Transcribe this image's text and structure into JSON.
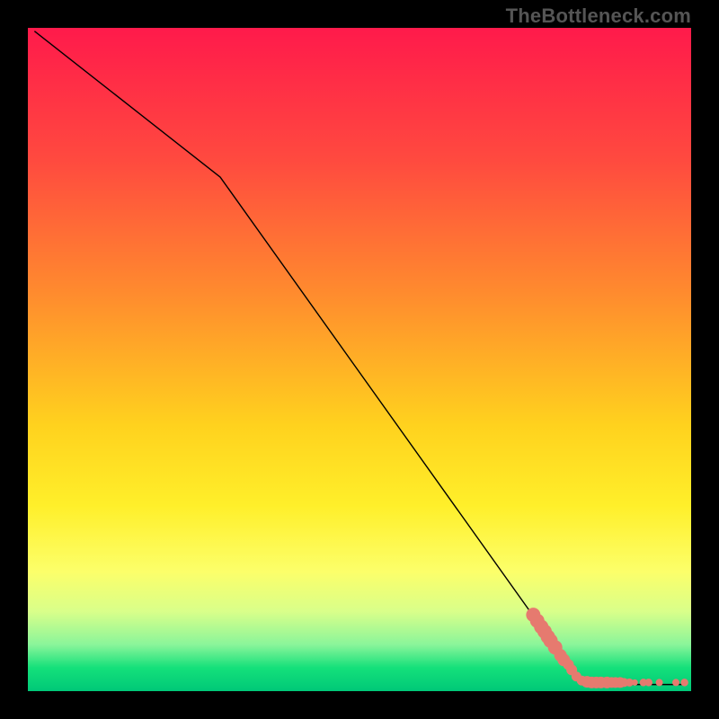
{
  "watermark": "TheBottleneck.com",
  "chart_data": {
    "type": "line",
    "title": "",
    "xlabel": "",
    "ylabel": "",
    "xlim": [
      0,
      100
    ],
    "ylim": [
      0,
      100
    ],
    "background_gradient": {
      "stops": [
        {
          "offset": 0.0,
          "color": "#ff1a4b"
        },
        {
          "offset": 0.2,
          "color": "#ff4a3f"
        },
        {
          "offset": 0.4,
          "color": "#ff8b2e"
        },
        {
          "offset": 0.6,
          "color": "#ffd21e"
        },
        {
          "offset": 0.72,
          "color": "#ffef2a"
        },
        {
          "offset": 0.82,
          "color": "#fcff6a"
        },
        {
          "offset": 0.88,
          "color": "#d9ff8a"
        },
        {
          "offset": 0.93,
          "color": "#8af59a"
        },
        {
          "offset": 0.965,
          "color": "#14e07a"
        },
        {
          "offset": 1.0,
          "color": "#00c878"
        }
      ]
    },
    "series": [
      {
        "name": "curve",
        "kind": "line",
        "color": "#000000",
        "stroke_width": 1.4,
        "points": [
          {
            "x": 1.0,
            "y": 99.5
          },
          {
            "x": 29.0,
            "y": 77.5
          },
          {
            "x": 82.5,
            "y": 2.5
          },
          {
            "x": 84.0,
            "y": 1.5
          },
          {
            "x": 86.0,
            "y": 1.0
          },
          {
            "x": 99.0,
            "y": 1.0
          }
        ]
      },
      {
        "name": "markers",
        "kind": "scatter",
        "color": "#e67a6f",
        "radius": 5,
        "points": [
          {
            "x": 76.2,
            "y": 11.5,
            "w": 1.6
          },
          {
            "x": 76.8,
            "y": 10.6,
            "w": 1.6
          },
          {
            "x": 77.4,
            "y": 9.7,
            "w": 1.6
          },
          {
            "x": 77.9,
            "y": 9.0,
            "w": 1.6
          },
          {
            "x": 78.4,
            "y": 8.2,
            "w": 1.6
          },
          {
            "x": 78.8,
            "y": 7.6,
            "w": 1.6
          },
          {
            "x": 79.5,
            "y": 6.6,
            "w": 1.6
          },
          {
            "x": 80.3,
            "y": 5.4,
            "w": 1.4
          },
          {
            "x": 80.8,
            "y": 4.7,
            "w": 1.4
          },
          {
            "x": 81.5,
            "y": 4.0,
            "w": 1.2
          },
          {
            "x": 82.0,
            "y": 3.2,
            "w": 1.2
          },
          {
            "x": 82.7,
            "y": 2.2,
            "w": 1.1
          },
          {
            "x": 83.5,
            "y": 1.6,
            "w": 1.1
          },
          {
            "x": 84.3,
            "y": 1.4,
            "w": 1.3
          },
          {
            "x": 85.0,
            "y": 1.3,
            "w": 1.3
          },
          {
            "x": 85.7,
            "y": 1.3,
            "w": 1.3
          },
          {
            "x": 86.4,
            "y": 1.3,
            "w": 1.3
          },
          {
            "x": 87.3,
            "y": 1.3,
            "w": 1.3
          },
          {
            "x": 88.0,
            "y": 1.3,
            "w": 1.2
          },
          {
            "x": 88.6,
            "y": 1.3,
            "w": 1.2
          },
          {
            "x": 89.3,
            "y": 1.3,
            "w": 1.2
          },
          {
            "x": 89.9,
            "y": 1.3,
            "w": 1.0
          },
          {
            "x": 90.7,
            "y": 1.3,
            "w": 0.9
          },
          {
            "x": 91.5,
            "y": 1.3,
            "w": 0.7
          },
          {
            "x": 92.8,
            "y": 1.3,
            "w": 0.85
          },
          {
            "x": 93.6,
            "y": 1.3,
            "w": 0.85
          },
          {
            "x": 95.2,
            "y": 1.3,
            "w": 0.8
          },
          {
            "x": 97.7,
            "y": 1.3,
            "w": 0.8
          },
          {
            "x": 99.0,
            "y": 1.3,
            "w": 0.85
          }
        ]
      }
    ]
  }
}
